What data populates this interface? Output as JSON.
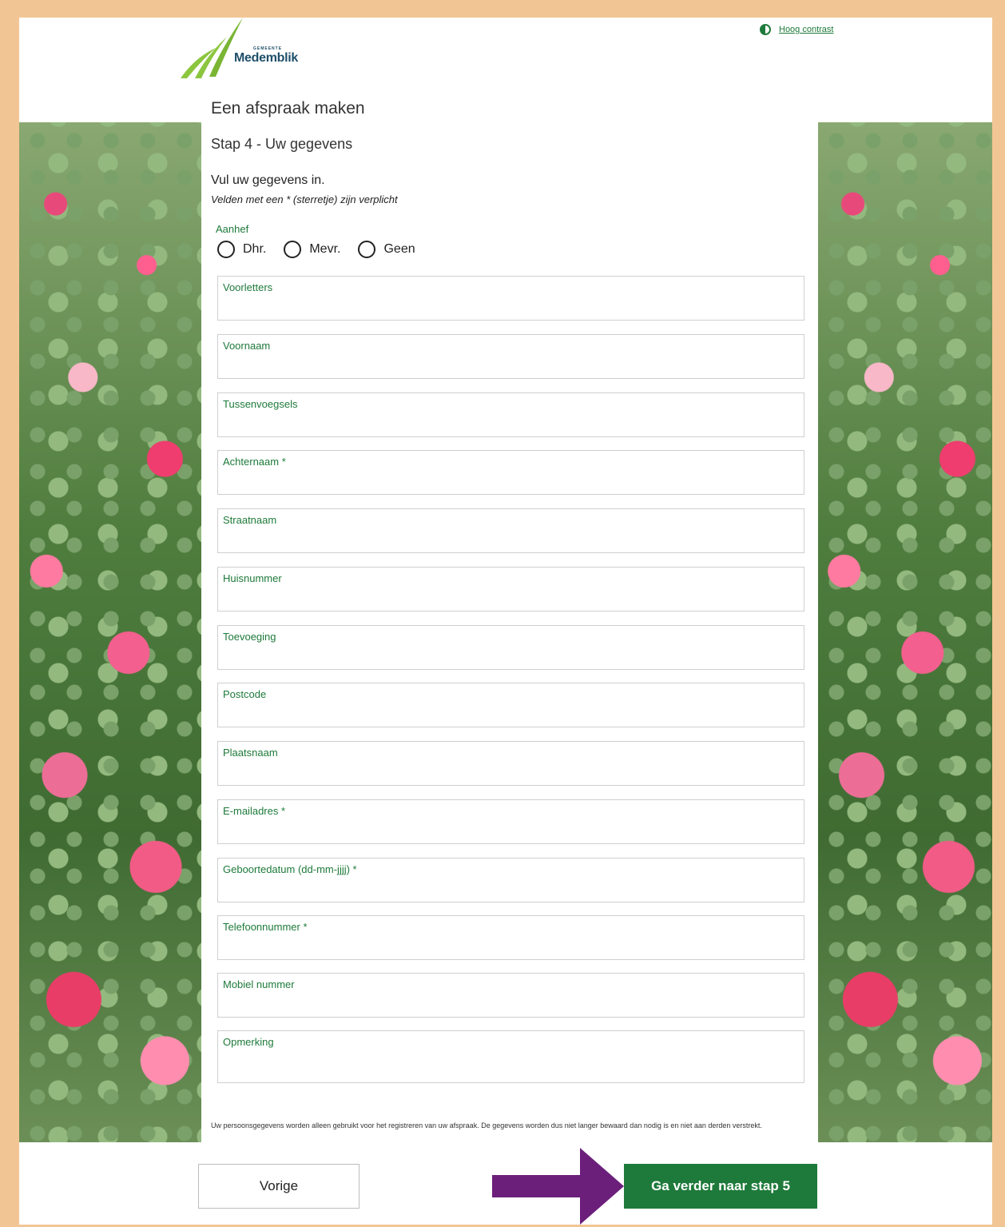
{
  "header": {
    "logo_small": "GEMEENTE",
    "logo_name": "Medemblik",
    "contrast_link": "Hoog contrast"
  },
  "page": {
    "title": "Een afspraak maken",
    "step": "Stap 4 - Uw gegevens",
    "intro": "Vul uw gegevens in.",
    "required_note": "Velden met een * (sterretje) zijn verplicht"
  },
  "salutation": {
    "label": "Aanhef",
    "options": [
      "Dhr.",
      "Mevr.",
      "Geen"
    ]
  },
  "fields": {
    "voorletters": "Voorletters",
    "voornaam": "Voornaam",
    "tussenvoegsels": "Tussenvoegsels",
    "achternaam": "Achternaam *",
    "straatnaam": "Straatnaam",
    "huisnummer": "Huisnummer",
    "toevoeging": "Toevoeging",
    "postcode": "Postcode",
    "plaatsnaam": "Plaatsnaam",
    "email": "E-mailadres *",
    "geboortedatum": "Geboortedatum (dd-mm-jjjj) *",
    "telefoon": "Telefoonnummer *",
    "mobiel": "Mobiel nummer",
    "opmerking": "Opmerking"
  },
  "privacy_text": "Uw persoonsgegevens worden alleen gebruikt voor het registreren van uw afspraak. De gegevens worden dus niet langer bewaard dan nodig is en niet aan derden verstrekt.",
  "buttons": {
    "prev": "Vorige",
    "next": "Ga verder naar stap 5"
  },
  "colors": {
    "accent": "#1e7a3a",
    "frame": "#f2c694",
    "annotation_arrow": "#6b1f7a"
  }
}
